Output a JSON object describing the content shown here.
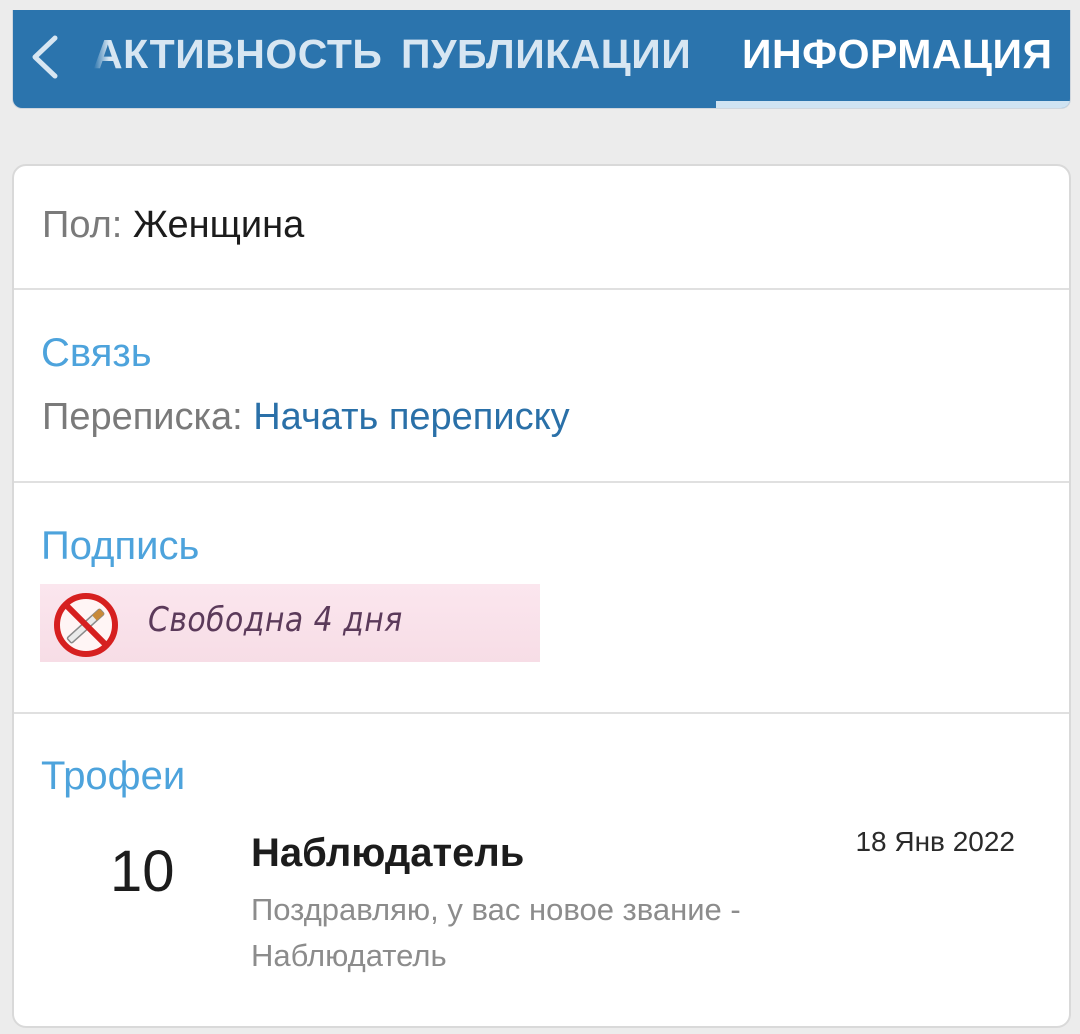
{
  "tabs": {
    "back_icon": "chevron-left-icon",
    "items": [
      {
        "label": "АКТИВНОСТЬ",
        "active": false
      },
      {
        "label": "ПУБЛИКАЦИИ",
        "active": false
      },
      {
        "label": "ИНФОРМАЦИЯ",
        "active": true
      }
    ],
    "bar_color": "#2b74ad",
    "underline_color": "#cfe3f2"
  },
  "profile": {
    "gender": {
      "label": "Пол:",
      "value": "Женщина"
    },
    "contact": {
      "heading": "Связь",
      "messaging_label": "Переписка:",
      "messaging_link": "Начать переписку"
    },
    "signature": {
      "heading": "Подпись",
      "icon": "no-smoking-icon",
      "text": "Свободна 4 дня"
    },
    "trophies": {
      "heading": "Трофеи",
      "items": [
        {
          "points": "10",
          "title": "Наблюдатель",
          "date": "18 Янв 2022",
          "description": "Поздравляю, у вас новое звание - Наблюдатель"
        }
      ]
    }
  },
  "colors": {
    "heading": "#4da3dc",
    "link": "#2a70a8",
    "label": "#7a7a7a"
  }
}
